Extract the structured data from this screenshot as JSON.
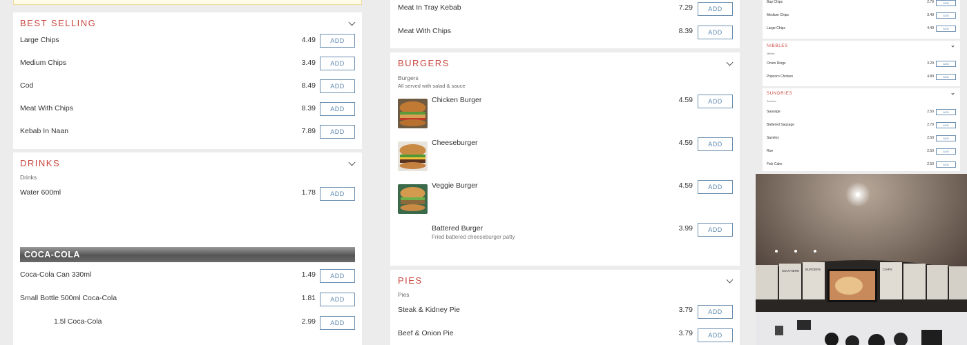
{
  "add_label": "ADD",
  "best_selling": {
    "title": "BEST SELLING",
    "items": [
      {
        "name": "Large Chips",
        "price": "4.49"
      },
      {
        "name": "Medium Chips",
        "price": "3.49"
      },
      {
        "name": "Cod",
        "price": "8.49"
      },
      {
        "name": "Meat With Chips",
        "price": "8.39"
      },
      {
        "name": "Kebab In Naan",
        "price": "7.89"
      }
    ]
  },
  "drinks": {
    "title": "DRINKS",
    "subtitle": "Drinks",
    "items": [
      {
        "name": "Water 600ml",
        "price": "1.78"
      }
    ],
    "banner": "COCA-COLA",
    "cola_items": [
      {
        "name": "Coca-Cola Can 330ml",
        "price": "1.49"
      },
      {
        "name": "Small Bottle 500ml Coca-Cola",
        "price": "1.81"
      },
      {
        "name": "1.5l Coca-Cola",
        "price": "2.99"
      }
    ]
  },
  "kebab_top": {
    "items": [
      {
        "name": "Meat In Tray Kebab",
        "price": "7.29"
      },
      {
        "name": "Meat With Chips",
        "price": "8.39"
      }
    ]
  },
  "burgers": {
    "title": "BURGERS",
    "subtitle_line1": "Burgers",
    "subtitle_line2": "All served with salad & sauce",
    "items": [
      {
        "name": "Chicken Burger",
        "price": "4.59",
        "desc": ""
      },
      {
        "name": "Cheeseburger",
        "price": "4.59",
        "desc": ""
      },
      {
        "name": "Veggie Burger",
        "price": "4.59",
        "desc": ""
      },
      {
        "name": "Battered Burger",
        "price": "3.99",
        "desc": "Fried battered cheeseburger patty"
      }
    ]
  },
  "pies": {
    "title": "PIES",
    "subtitle": "Pies",
    "items": [
      {
        "name": "Steak & Kidney Pie",
        "price": "3.79"
      },
      {
        "name": "Beef & Onion Pie",
        "price": "3.79"
      }
    ]
  },
  "mini": {
    "top_items": [
      {
        "name": "Bap Chips",
        "price": "2.79"
      },
      {
        "name": "Medium Chips",
        "price": "3.49"
      },
      {
        "name": "Large Chips",
        "price": "4.49"
      }
    ],
    "nibbles": {
      "title": "NIBBLES",
      "subtitle": "Nibbles",
      "items": [
        {
          "name": "Onion Rings",
          "price": "3.29"
        },
        {
          "name": "Popcorn Chicken",
          "price": "4.89"
        }
      ]
    },
    "sundries": {
      "title": "SUNDRIES",
      "subtitle": "Sundries",
      "items": [
        {
          "name": "Sausage",
          "price": "2.50"
        },
        {
          "name": "Battered Sausage",
          "price": "2.70"
        },
        {
          "name": "Saveloy",
          "price": "2.50"
        },
        {
          "name": "Roe",
          "price": "2.50"
        },
        {
          "name": "Fish Cake",
          "price": "2.50"
        }
      ]
    }
  },
  "photo": {
    "board_labels": [
      "SOUTHERN",
      "BURGERS",
      "CHIPS"
    ]
  },
  "colors": {
    "accent": "#c9453d",
    "button": "#5b86ad"
  }
}
